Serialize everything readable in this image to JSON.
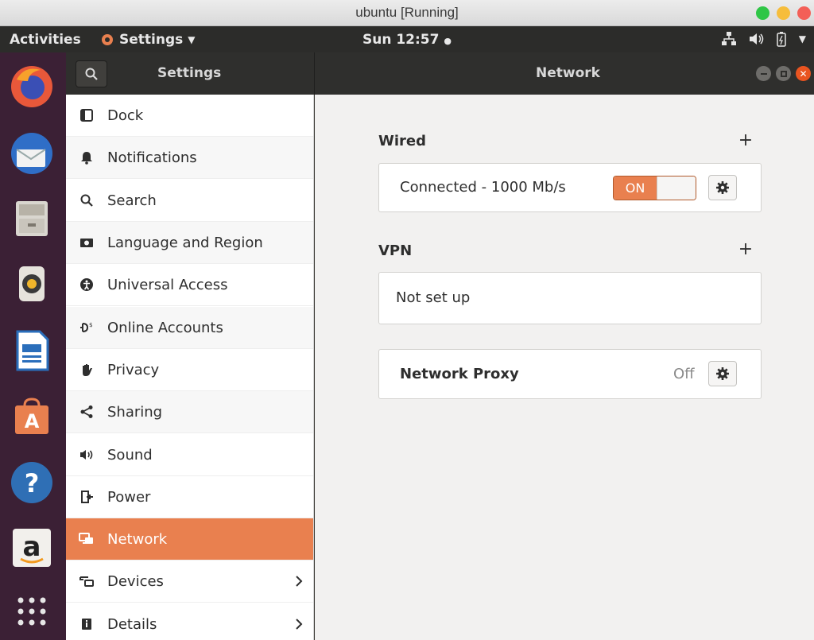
{
  "vm_window": {
    "title": "ubuntu [Running]"
  },
  "topbar": {
    "activities": "Activities",
    "app_menu": "Settings",
    "clock": "Sun 12:57"
  },
  "dock": {
    "apps": [
      "firefox-icon",
      "thunderbird-icon",
      "files-icon",
      "rhythmbox-icon",
      "writer-icon",
      "software-icon",
      "help-icon",
      "amazon-icon",
      "show-apps-icon"
    ]
  },
  "header": {
    "sidebar_title": "Settings",
    "panel_title": "Network"
  },
  "sidebar": {
    "items": [
      {
        "label": "Dock",
        "icon": "dock-icon"
      },
      {
        "label": "Notifications",
        "icon": "bell-icon"
      },
      {
        "label": "Search",
        "icon": "search-icon"
      },
      {
        "label": "Language and Region",
        "icon": "camera-icon"
      },
      {
        "label": "Universal Access",
        "icon": "accessibility-icon"
      },
      {
        "label": "Online Accounts",
        "icon": "accounts-icon"
      },
      {
        "label": "Privacy",
        "icon": "hand-icon"
      },
      {
        "label": "Sharing",
        "icon": "share-icon"
      },
      {
        "label": "Sound",
        "icon": "speaker-icon"
      },
      {
        "label": "Power",
        "icon": "power-icon"
      },
      {
        "label": "Network",
        "icon": "network-icon",
        "active": true
      },
      {
        "label": "Devices",
        "icon": "devices-icon"
      },
      {
        "label": "Details",
        "icon": "info-icon"
      }
    ]
  },
  "main": {
    "wired": {
      "title": "Wired",
      "status": "Connected - 1000 Mb/s",
      "toggle_label": "ON"
    },
    "vpn": {
      "title": "VPN",
      "status": "Not set up"
    },
    "proxy": {
      "title": "Network Proxy",
      "state": "Off"
    }
  },
  "colors": {
    "accent": "#e9804f",
    "dock_bg": "#3b2035",
    "topbar_bg": "#2c2c2a"
  }
}
